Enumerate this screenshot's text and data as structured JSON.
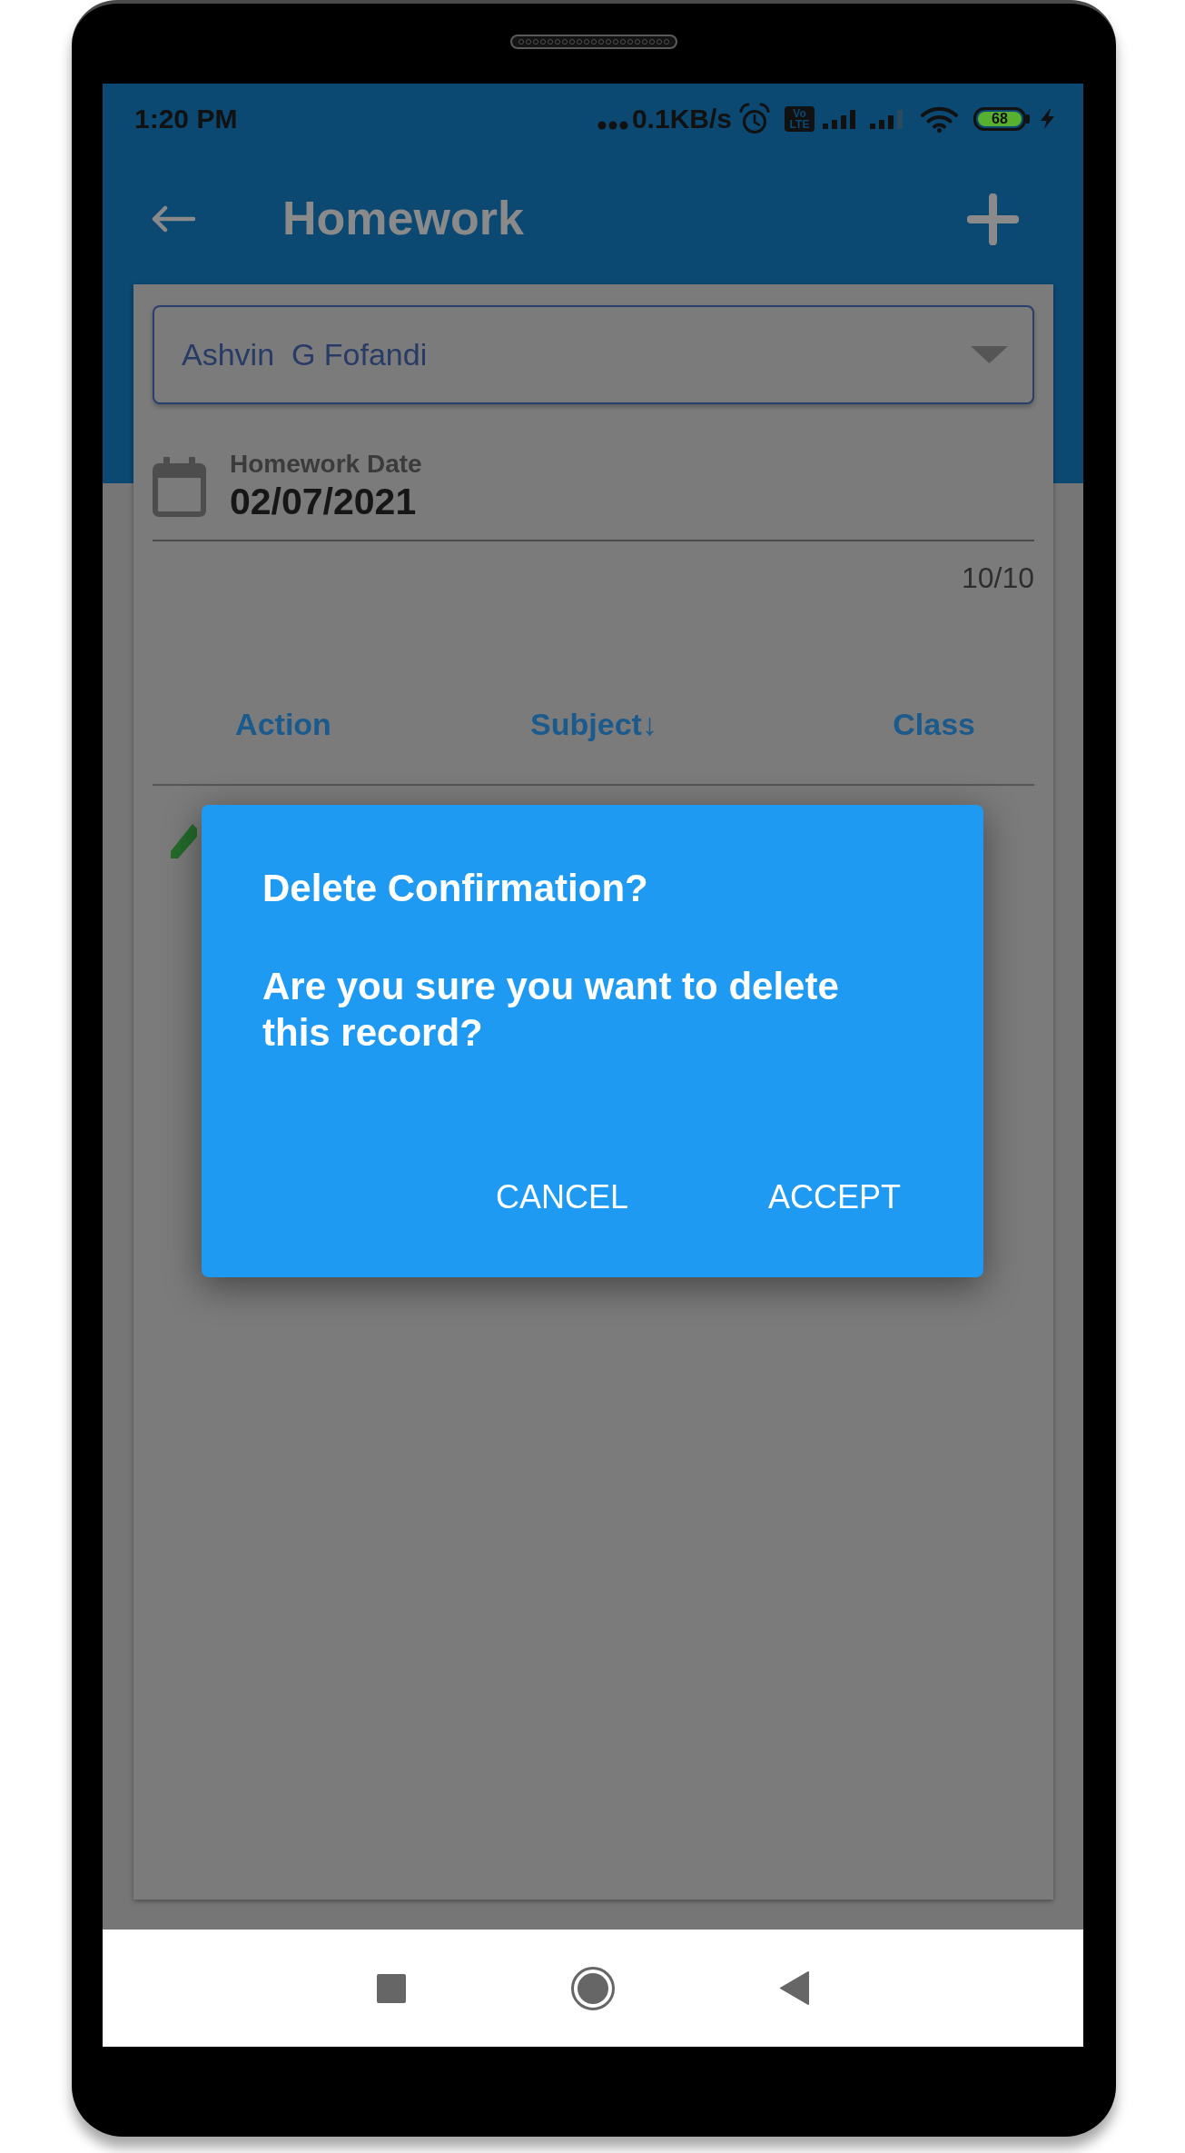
{
  "status_bar": {
    "time": "1:20 PM",
    "network_speed": "0.1KB/s",
    "volte_badge": [
      "Vo",
      "LTE"
    ],
    "battery": "68"
  },
  "app_bar": {
    "title": "Homework"
  },
  "form": {
    "student": {
      "value": "Ashvin  G Fofandi"
    },
    "homework_date": {
      "label": "Homework Date",
      "value": "02/07/2021"
    },
    "counter": "10/10"
  },
  "table": {
    "columns": [
      "Action",
      "Subject↓",
      "Class"
    ],
    "rows": [
      {
        "kind": "edit"
      }
    ]
  },
  "dialog": {
    "title": "Delete Confirmation?",
    "message": "Are you sure you want to delete this record?",
    "buttons": [
      "CANCEL",
      "ACCEPT"
    ]
  }
}
